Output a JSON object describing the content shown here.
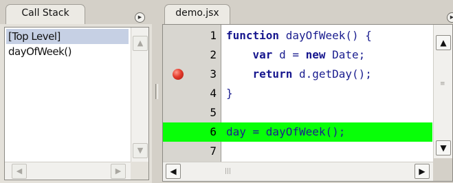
{
  "call_stack_panel": {
    "tab_label": "Call Stack",
    "items": [
      {
        "label": "[Top Level]",
        "selected": true
      },
      {
        "label": "dayOfWeek()",
        "selected": false
      }
    ]
  },
  "editor_panel": {
    "tab_label": "demo.jsx",
    "current_line": 6,
    "breakpoint_line": 3,
    "lines": [
      {
        "num": "1",
        "segments": [
          {
            "kw": true,
            "t": "function"
          },
          {
            "kw": false,
            "t": " dayOfWeek() {"
          }
        ]
      },
      {
        "num": "2",
        "segments": [
          {
            "kw": false,
            "t": "    "
          },
          {
            "kw": true,
            "t": "var"
          },
          {
            "kw": false,
            "t": " d = "
          },
          {
            "kw": true,
            "t": "new"
          },
          {
            "kw": false,
            "t": " Date;"
          }
        ]
      },
      {
        "num": "3",
        "segments": [
          {
            "kw": false,
            "t": "    "
          },
          {
            "kw": true,
            "t": "return"
          },
          {
            "kw": false,
            "t": " d.getDay();"
          }
        ]
      },
      {
        "num": "4",
        "segments": [
          {
            "kw": false,
            "t": "}"
          }
        ]
      },
      {
        "num": "5",
        "segments": []
      },
      {
        "num": "6",
        "segments": [
          {
            "kw": false,
            "t": "day = dayOfWeek();"
          }
        ]
      },
      {
        "num": "7",
        "segments": []
      }
    ]
  },
  "icons": {
    "panel_menu": "circle-arrow-right-icon",
    "scroll_up": "arrow-up-icon",
    "scroll_down": "arrow-down-icon",
    "scroll_left": "arrow-left-icon",
    "scroll_right": "arrow-right-icon",
    "breakpoint": "breakpoint-icon"
  },
  "colors": {
    "current_line_highlight": "#08ff08",
    "selected_item": "#c6d0e4",
    "breakpoint": "#e43b2c",
    "code_text": "#1a1d8f"
  }
}
